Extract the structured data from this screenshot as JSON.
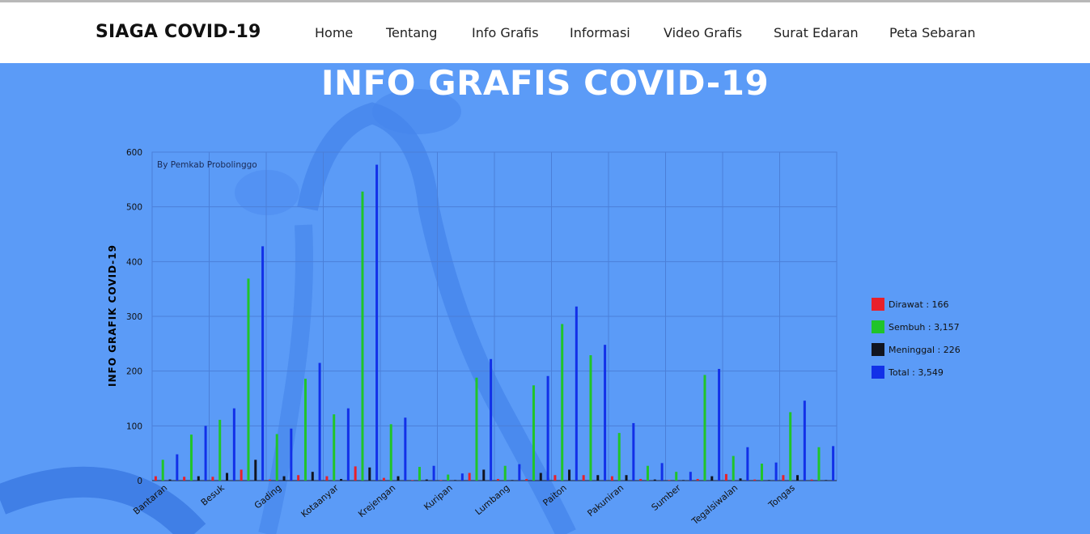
{
  "brand": "SIAGA COVID-19",
  "nav": [
    "Home",
    "Tentang",
    "Info Grafis",
    "Informasi",
    "Video Grafis",
    "Surat Edaran",
    "Peta Sebaran"
  ],
  "page_title": "INFO GRAFIS COVID-19",
  "colors": {
    "background": "#5b9bf7",
    "dirawat": "#e8202a",
    "sembuh": "#20c42a",
    "meninggal": "#111520",
    "total": "#1230e8"
  },
  "chart_data": {
    "type": "bar",
    "credit": "By Pemkab Probolinggo",
    "ylabel": "INFO GRAFIK COVID-19",
    "xlabel": "",
    "ylim": [
      0,
      600
    ],
    "yticks": [
      0,
      100,
      200,
      300,
      400,
      500,
      600
    ],
    "grid": true,
    "legend_position": "right",
    "categories": [
      "Bantaran",
      "",
      "Besuk",
      "",
      "Gading",
      "",
      "Kotaanyar",
      "",
      "Krejengan",
      "",
      "Kuripan",
      "",
      "Lumbang",
      "",
      "Paiton",
      "",
      "Pakuniran",
      "",
      "Sumber",
      "",
      "Tegalsiwalan",
      "",
      "Tongas",
      ""
    ],
    "series": [
      {
        "name": "Dirawat",
        "legend": "Dirawat : 166",
        "values": [
          8,
          7,
          7,
          20,
          2,
          10,
          8,
          26,
          5,
          1,
          1,
          14,
          3,
          3,
          10,
          10,
          8,
          3,
          1,
          3,
          12,
          2,
          10,
          2
        ]
      },
      {
        "name": "Sembuh",
        "legend": "Sembuh : 3,157",
        "values": [
          38,
          84,
          111,
          369,
          85,
          186,
          121,
          528,
          103,
          25,
          11,
          188,
          27,
          174,
          286,
          229,
          87,
          27,
          16,
          193,
          45,
          31,
          125,
          61
        ]
      },
      {
        "name": "Meninggal",
        "legend": "Meninggal : 226",
        "values": [
          2,
          8,
          14,
          38,
          8,
          16,
          3,
          24,
          8,
          2,
          1,
          20,
          1,
          14,
          20,
          10,
          10,
          2,
          1,
          8,
          4,
          1,
          10,
          1
        ]
      },
      {
        "name": "Total",
        "legend": "Total : 3,549",
        "values": [
          48,
          100,
          132,
          428,
          95,
          215,
          132,
          577,
          115,
          27,
          13,
          222,
          30,
          191,
          318,
          248,
          105,
          32,
          16,
          204,
          61,
          33,
          146,
          63
        ]
      }
    ]
  }
}
